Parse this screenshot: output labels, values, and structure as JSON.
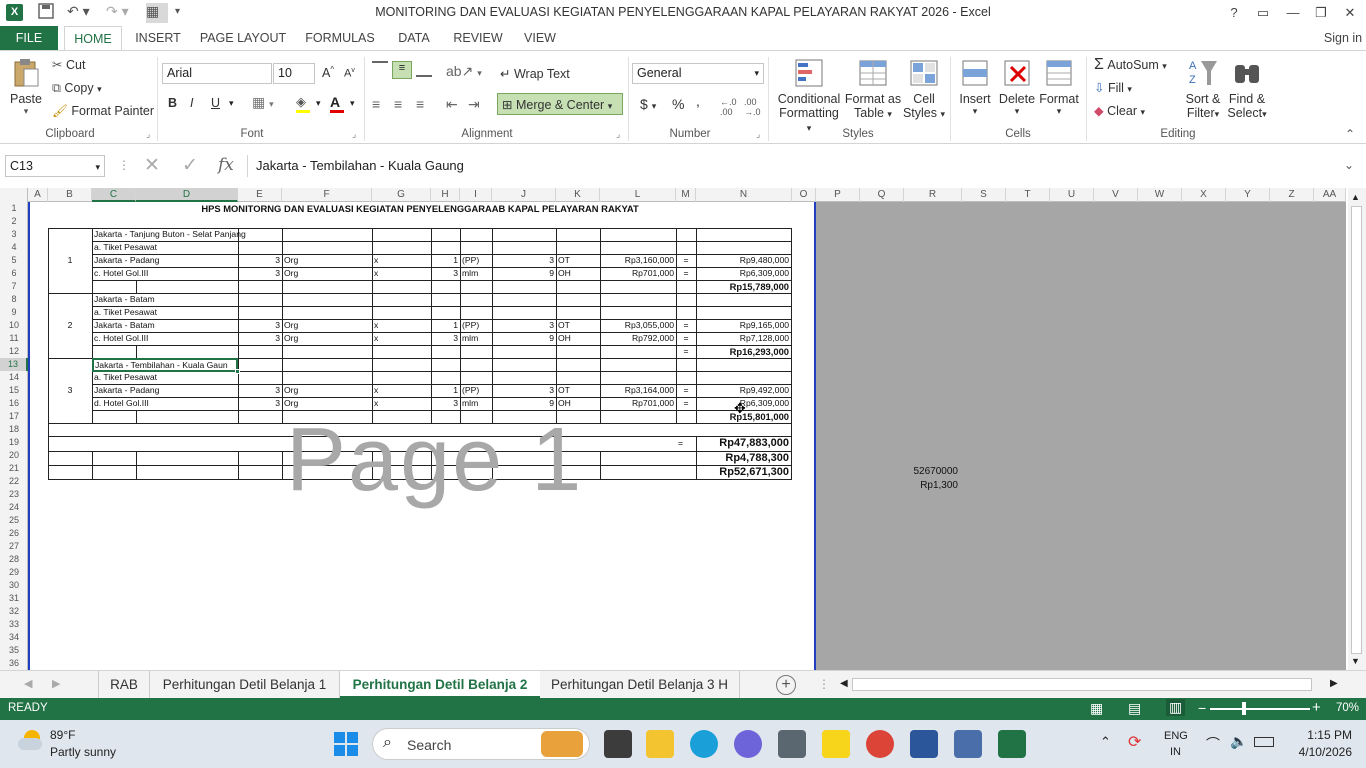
{
  "window": {
    "title": "MONITORING DAN EVALUASI KEGIATAN PENYELENGGARAAN KAPAL PELAYARAN RAKYAT 2026 - Excel",
    "help": "?",
    "sign_in": "Sign in"
  },
  "ribbon_tabs": [
    "FILE",
    "HOME",
    "INSERT",
    "PAGE LAYOUT",
    "FORMULAS",
    "DATA",
    "REVIEW",
    "VIEW"
  ],
  "clipboard": {
    "paste": "Paste",
    "cut": "Cut",
    "copy": "Copy",
    "format_painter": "Format Painter",
    "label": "Clipboard"
  },
  "font": {
    "name": "Arial",
    "size": "10",
    "bold": "B",
    "italic": "I",
    "underline": "U",
    "label": "Font"
  },
  "alignment": {
    "wrap_text": "Wrap Text",
    "merge_center": "Merge & Center",
    "label": "Alignment"
  },
  "number": {
    "format": "General",
    "currency": "$",
    "percent": "%",
    "comma": ",",
    "label": "Number"
  },
  "styles": {
    "conditional": "Conditional",
    "conditional2": "Formatting",
    "format_as": "Format as",
    "format_as2": "Table",
    "cell": "Cell",
    "cell2": "Styles",
    "label": "Styles"
  },
  "cells": {
    "insert": "Insert",
    "delete": "Delete",
    "format": "Format",
    "label": "Cells"
  },
  "editing": {
    "autosum": "AutoSum",
    "fill": "Fill",
    "clear": "Clear",
    "sort": "Sort &",
    "sort2": "Filter",
    "find": "Find &",
    "find2": "Select",
    "label": "Editing"
  },
  "formula_bar": {
    "name_box": "C13",
    "fx": "fx",
    "content": "Jakarta - Tembilahan - Kuala Gaung"
  },
  "columns": [
    "A",
    "B",
    "C",
    "D",
    "E",
    "F",
    "G",
    "H",
    "I",
    "J",
    "K",
    "L",
    "M",
    "N",
    "O",
    "P",
    "Q",
    "R",
    "S",
    "T",
    "U",
    "V",
    "W",
    "X",
    "Y",
    "Z",
    "AA"
  ],
  "rows": [
    "1",
    "2",
    "3",
    "4",
    "5",
    "6",
    "7",
    "8",
    "9",
    "10",
    "11",
    "12",
    "13",
    "14",
    "15",
    "16",
    "17",
    "18",
    "19",
    "20",
    "21",
    "22",
    "23",
    "24",
    "25",
    "26",
    "27",
    "28",
    "29",
    "30",
    "31",
    "32",
    "33",
    "34",
    "35",
    "36"
  ],
  "sheet": {
    "title": "HPS  MONITORNG DAN EVALUASI KEGIATAN PENYELENGGARAAB KAPAL PELAYARAN RAKYAT",
    "groups": [
      {
        "no": "1",
        "route": "Jakarta - Tanjung Buton - Selat Panjang",
        "ticket_label": "a. Tiket Pesawat",
        "lines": [
          {
            "desc": "Jakarta - Padang",
            "qty": "3",
            "unit": "Org",
            "x": "x",
            "qty2": "1",
            "unit2": "(PP)",
            "total_qty": "3",
            "unit3": "OT",
            "price": "Rp3,160,000",
            "eq": "=",
            "amount": "Rp9,480,000"
          },
          {
            "desc": "c. Hotel Gol.III",
            "qty": "3",
            "unit": "Org",
            "x": "x",
            "qty2": "3",
            "unit2": "mlm",
            "total_qty": "9",
            "unit3": "OH",
            "price": "Rp701,000",
            "eq": "=",
            "amount": "Rp6,309,000"
          }
        ],
        "subtotal_eq": "",
        "subtotal": "Rp15,789,000"
      },
      {
        "no": "2",
        "route": "Jakarta - Batam",
        "ticket_label": "a. Tiket Pesawat",
        "lines": [
          {
            "desc": "Jakarta - Batam",
            "qty": "3",
            "unit": "Org",
            "x": "x",
            "qty2": "1",
            "unit2": "(PP)",
            "total_qty": "3",
            "unit3": "OT",
            "price": "Rp3,055,000",
            "eq": "=",
            "amount": "Rp9,165,000"
          },
          {
            "desc": "c. Hotel Gol.III",
            "qty": "3",
            "unit": "Org",
            "x": "x",
            "qty2": "3",
            "unit2": "mlm",
            "total_qty": "9",
            "unit3": "OH",
            "price": "Rp792,000",
            "eq": "=",
            "amount": "Rp7,128,000"
          }
        ],
        "subtotal_eq": "=",
        "subtotal": "Rp16,293,000"
      },
      {
        "no": "3",
        "route": "Jakarta - Tembilahan - Kuala Gaun",
        "ticket_label": "a. Tiket Pesawat",
        "lines": [
          {
            "desc": "Jakarta - Padang",
            "qty": "3",
            "unit": "Org",
            "x": "x",
            "qty2": "1",
            "unit2": "(PP)",
            "total_qty": "3",
            "unit3": "OT",
            "price": "Rp3,164,000",
            "eq": "=",
            "amount": "Rp9,492,000"
          },
          {
            "desc": "d. Hotel Gol.III",
            "qty": "3",
            "unit": "Org",
            "x": "x",
            "qty2": "3",
            "unit2": "mlm",
            "total_qty": "9",
            "unit3": "OH",
            "price": "Rp701,000",
            "eq": "=",
            "amount": "Rp6,309,000"
          }
        ],
        "subtotal_eq": "",
        "subtotal": "Rp15,801,000"
      }
    ],
    "total_eq": "=",
    "total": "Rp47,883,000",
    "tax": "Rp4,788,300",
    "grand_total": "Rp52,671,300",
    "r21_value": "52670000",
    "r22_value": "Rp1,300",
    "watermark": "Page 1"
  },
  "sheet_tabs": [
    "RAB",
    "Perhitungan Detil Belanja 1",
    "Perhitungan Detil Belanja 2",
    "Perhitungan Detil Belanja 3 H"
  ],
  "status": {
    "mode": "READY",
    "zoom": "70%"
  },
  "taskbar": {
    "weather_temp": "89°F",
    "weather_desc": "Partly sunny",
    "search": "Search",
    "lang1": "ENG",
    "lang2": "IN",
    "time": "1:15 PM",
    "date": "4/10/2026"
  },
  "colors": {
    "excel_green": "#217346",
    "grey_area": "#a6a6a6"
  }
}
